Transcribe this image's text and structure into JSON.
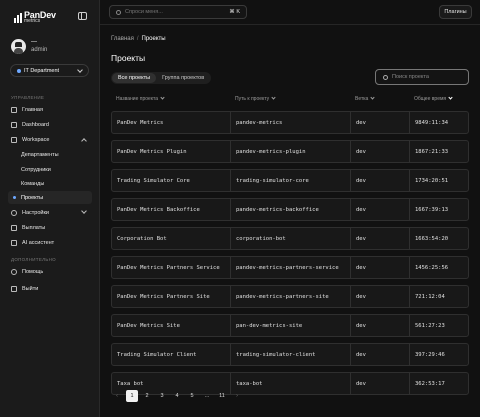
{
  "brand": {
    "name": "PanDev",
    "sub": "metrics"
  },
  "profile": {
    "name": "—",
    "role": "admin"
  },
  "department": {
    "label": "IT Department"
  },
  "sections": {
    "manage": "УПРАВЛЕНИЕ",
    "extra": "ДОПОЛНИТЕЛЬНО"
  },
  "nav": {
    "home": "Главная",
    "dashboard": "Dashboard",
    "workspace": "Workspace",
    "departments": "Департаменты",
    "employees": "Сотрудники",
    "teams": "Команды",
    "projects": "Проекты",
    "settings": "Настройки",
    "payouts": "Выплаты",
    "ai": "AI ассистент",
    "help": "Помощь",
    "logout": "Выйти"
  },
  "topbar": {
    "search_placeholder": "Спроси меня...",
    "shortcut": "⌘ K",
    "plugins": "Плагины"
  },
  "breadcrumb": {
    "home": "Главная",
    "sep": "/",
    "current": "Проекты"
  },
  "page_title": "Проекты",
  "tabs": [
    "Все проекты",
    "Группа проектов"
  ],
  "project_search_placeholder": "Поиск проекта",
  "columns": [
    "Название проекта",
    "Путь к проекту",
    "Ветка",
    "Общее время"
  ],
  "rows": [
    {
      "name": "PanDev Metrics",
      "path": "pandev-metrics",
      "branch": "dev",
      "time": "9849:11:34"
    },
    {
      "name": "PanDev Metrics Plugin",
      "path": "pandev-metrics-plugin",
      "branch": "dev",
      "time": "1867:21:33"
    },
    {
      "name": "Trading Simulator Core",
      "path": "trading-simulator-core",
      "branch": "dev",
      "time": "1734:20:51"
    },
    {
      "name": "PanDev Metrics Backoffice",
      "path": "pandev-metrics-backoffice",
      "branch": "dev",
      "time": "1667:39:13"
    },
    {
      "name": "Corporation Bot",
      "path": "corporation-bot",
      "branch": "dev",
      "time": "1663:54:20"
    },
    {
      "name": "PanDev Metrics Partners Service",
      "path": "pandev-metrics-partners-service",
      "branch": "dev",
      "time": "1456:25:56"
    },
    {
      "name": "PanDev Metrics Partners Site",
      "path": "pandev-metrics-partners-site",
      "branch": "dev",
      "time": "721:12:04"
    },
    {
      "name": "PanDev Metrics Site",
      "path": "pan-dev-metrics-site",
      "branch": "dev",
      "time": "561:27:23"
    },
    {
      "name": "Trading Simulator Client",
      "path": "trading-simulator-client",
      "branch": "dev",
      "time": "397:29:46"
    },
    {
      "name": "Taxa bot",
      "path": "taxa-bot",
      "branch": "dev",
      "time": "362:53:17"
    }
  ],
  "pagination": {
    "prev": "‹",
    "pages": [
      "1",
      "2",
      "3",
      "4",
      "5",
      "…",
      "11"
    ],
    "next": "›",
    "active": "1"
  }
}
